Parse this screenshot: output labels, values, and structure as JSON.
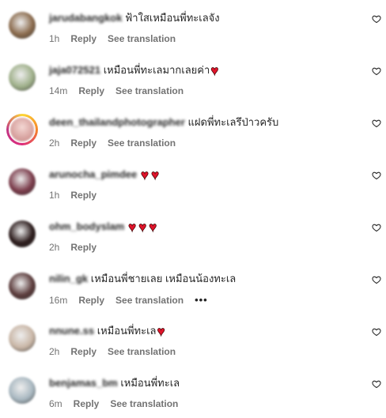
{
  "comments": [
    {
      "username": "jarudabangkok",
      "text": "ฟ้าใสเหมือนพี่ทะเลจัง",
      "hearts": 0,
      "time": "1h",
      "reply": "Reply",
      "see_translation": "See translation",
      "has_translation": true,
      "has_more": false,
      "avatar_color": "#8a6a4c"
    },
    {
      "username": "jaja072521",
      "text": "เหมือนพี่ทะเลมากเลยค่า",
      "hearts": 1,
      "time": "14m",
      "reply": "Reply",
      "see_translation": "See translation",
      "has_translation": true,
      "has_more": false,
      "avatar_color": "#9fb08a"
    },
    {
      "username": "deen_thailandphotographer",
      "text": "แฝดพี่ทะเลรึป่าวครับ",
      "hearts": 0,
      "time": "2h",
      "reply": "Reply",
      "see_translation": "See translation",
      "has_translation": true,
      "has_more": false,
      "avatar_color": "#d8a3a0",
      "story_ring": true
    },
    {
      "username": "arunocha_pimdee",
      "text": "",
      "hearts": 2,
      "time": "1h",
      "reply": "Reply",
      "see_translation": "",
      "has_translation": false,
      "has_more": false,
      "avatar_color": "#7a3b4a"
    },
    {
      "username": "ohm_bodyslam",
      "text": "",
      "hearts": 3,
      "time": "2h",
      "reply": "Reply",
      "see_translation": "",
      "has_translation": false,
      "has_more": false,
      "avatar_color": "#2a1a1a"
    },
    {
      "username": "nilin_gk",
      "text": "เหมือนพี่ชายเลย เหมือนน้องทะเล",
      "hearts": 0,
      "time": "16m",
      "reply": "Reply",
      "see_translation": "See translation",
      "has_translation": true,
      "has_more": true,
      "more_label": "•••",
      "avatar_color": "#5a3a3a"
    },
    {
      "username": "nnune.ss",
      "text": "เหมือนพี่ทะเล",
      "hearts": 1,
      "time": "2h",
      "reply": "Reply",
      "see_translation": "See translation",
      "has_translation": true,
      "has_more": false,
      "avatar_color": "#c9b6a6"
    },
    {
      "username": "benjamas_bm",
      "text": "เหมือนพี่ทะเล",
      "hearts": 0,
      "time": "6m",
      "reply": "Reply",
      "see_translation": "See translation",
      "has_translation": true,
      "has_more": false,
      "avatar_color": "#a8b7c0"
    }
  ],
  "icons": {
    "like": "heart-outline-icon",
    "reaction": "red-heart-emoji"
  },
  "colors": {
    "username": "#262626",
    "meta": "#737373",
    "heart": "#e0142b"
  }
}
